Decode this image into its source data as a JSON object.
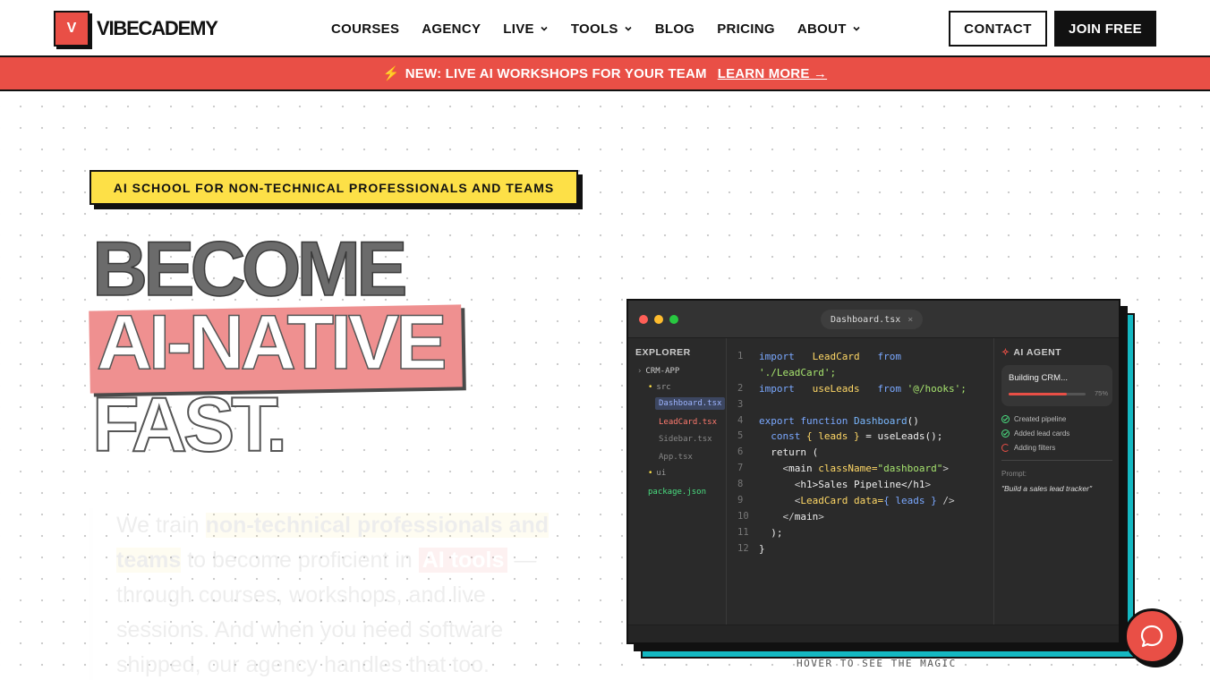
{
  "nav": {
    "logo_letter": "V",
    "logo_text": "VIBECADEMY",
    "items": [
      {
        "label": "COURSES",
        "dropdown": false
      },
      {
        "label": "AGENCY",
        "dropdown": false
      },
      {
        "label": "LIVE",
        "dropdown": true
      },
      {
        "label": "TOOLS",
        "dropdown": true
      },
      {
        "label": "BLOG",
        "dropdown": false
      },
      {
        "label": "PRICING",
        "dropdown": false
      },
      {
        "label": "ABOUT",
        "dropdown": true
      }
    ],
    "contact_label": "CONTACT",
    "join_label": "JOIN FREE"
  },
  "banner": {
    "icon": "⚡",
    "text": "NEW: LIVE AI WORKSHOPS FOR YOUR TEAM",
    "link": "LEARN MORE →"
  },
  "hero": {
    "badge": "AI SCHOOL FOR NON-TECHNICAL PROFESSIONALS AND TEAMS",
    "line1": "BECOME",
    "line2": "AI-NATIVE",
    "line3": "FAST.",
    "desc_1": "We train",
    "desc_hl": "non-technical professionals and teams",
    "desc_2": "to become proficient in",
    "desc_hl2": "AI tools",
    "desc_3": "— through courses, workshops, and live sessions. And when you need software shipped, our agency handles that too."
  },
  "editor": {
    "tab": "Dashboard.tsx",
    "tab_close": "×",
    "explorer_title": "EXPLORER",
    "tree": {
      "root": "CRM-APP",
      "src": "src",
      "files": [
        "Dashboard.tsx",
        "LeadCard.tsx",
        "Sidebar.tsx",
        "App.tsx"
      ],
      "ui": "ui",
      "pkg": "package.json"
    },
    "line_numbers": [
      "1",
      "",
      "2",
      "3",
      "4",
      "5",
      "6",
      "7",
      "8",
      "9",
      "10",
      "11",
      "12"
    ],
    "code": {
      "l1a": "import",
      "l1b": "LeadCard",
      "l1c": "from",
      "l1d": "'./LeadCard';",
      "l2a": "import",
      "l2b": "useLeads",
      "l2c": "from",
      "l2d": "'@/hooks';",
      "l4a": "export function",
      "l4b": "Dashboard",
      "l4c": "()",
      "l5a": "const",
      "l5b": "{ leads }",
      "l5c": "= useLeads();",
      "l6": "return (",
      "l7a": "<",
      "l7b": "main",
      "l7c": "className=",
      "l7d": "\"dashboard\"",
      "l7e": ">",
      "l8a": "<",
      "l8b": "h1",
      "l8c": ">Sales Pipeline</",
      "l8d": "h1",
      "l8e": ">",
      "l9a": "<",
      "l9b": "LeadCard",
      "l9c": "data=",
      "l9d": "{ leads }",
      "l9e": "/>",
      "l10a": "</",
      "l10b": "main",
      "l10c": ">",
      "l11": ");",
      "l12": "}"
    },
    "agent": {
      "title": "AI AGENT",
      "task": "Building CRM...",
      "progress": 0.75,
      "progress_label": "75%",
      "steps": [
        "Created pipeline",
        "Added lead cards",
        "Adding filters"
      ],
      "prompt_label": "Prompt:",
      "prompt": "\"Build a sales lead tracker\""
    },
    "caption": "HOVER TO SEE THE MAGIC"
  },
  "colors": {
    "accent": "#e94f46",
    "badge": "#fde047",
    "teal": "#14b8c2",
    "ink": "#111111"
  }
}
